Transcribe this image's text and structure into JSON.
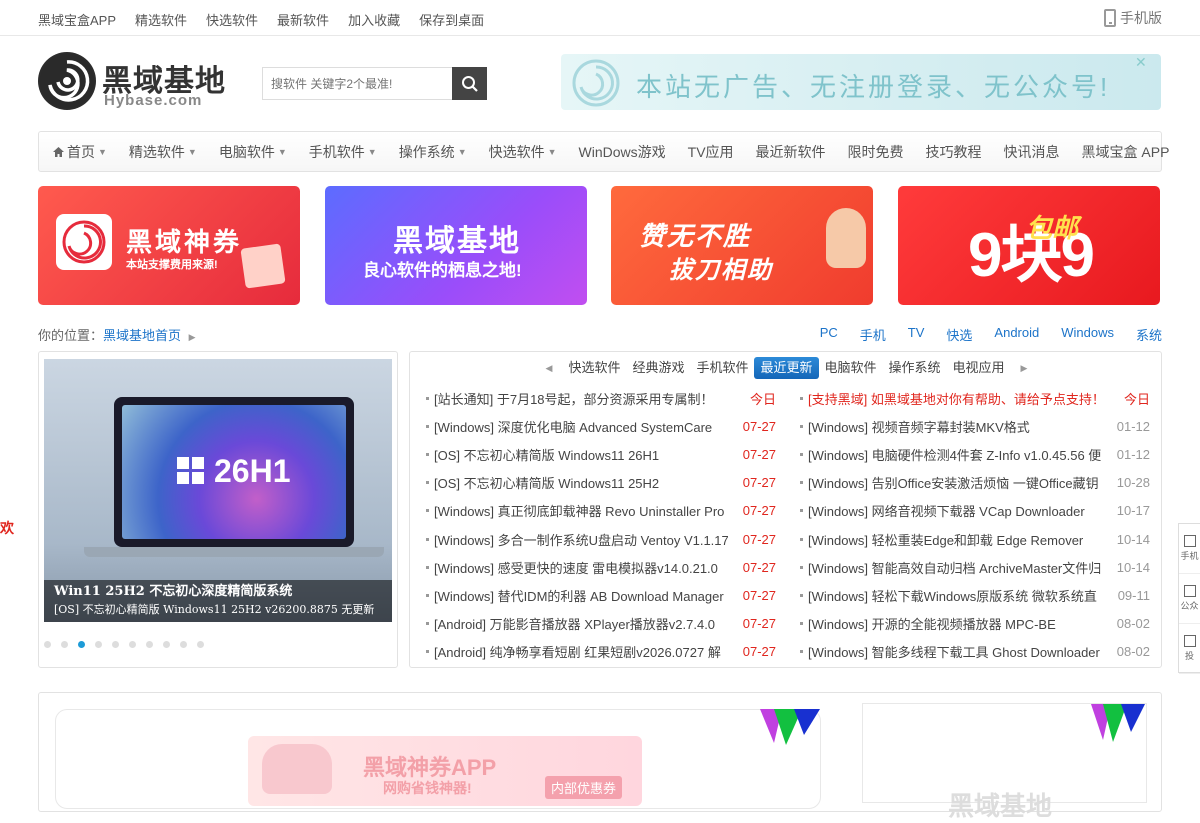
{
  "topbar": {
    "links": [
      "黑域宝盒APP",
      "精选软件",
      "快选软件",
      "最新软件",
      "加入收藏",
      "保存到桌面"
    ],
    "mobile_label": "手机版"
  },
  "header": {
    "logo_text": "黑域基地",
    "logo_sub": "Hybase.com",
    "search_placeholder": "搜软件 关键字2个最准!",
    "banner_text": "本站无广告、无注册登录、无公众号!"
  },
  "nav": {
    "items": [
      {
        "label": "首页",
        "caret": true
      },
      {
        "label": "精选软件",
        "caret": true
      },
      {
        "label": "电脑软件",
        "caret": true
      },
      {
        "label": "手机软件",
        "caret": true
      },
      {
        "label": "操作系统",
        "caret": true
      },
      {
        "label": "快选软件",
        "caret": true
      },
      {
        "label": "WinDows游戏",
        "caret": false
      },
      {
        "label": "TV应用",
        "caret": false
      },
      {
        "label": "最近新软件",
        "caret": false
      },
      {
        "label": "限时免费",
        "caret": false
      },
      {
        "label": "技巧教程",
        "caret": false
      },
      {
        "label": "快讯消息",
        "caret": false
      },
      {
        "label": "黑域宝盒 APP",
        "caret": false
      }
    ]
  },
  "promos": [
    {
      "title": "黑域神券",
      "subtitle": "本站支撑费用来源!"
    },
    {
      "title": "黑域基地",
      "subtitle": "良心软件的栖息之地!"
    },
    {
      "title": "赞无不胜",
      "subtitle": "拔刀相助"
    },
    {
      "title": "9块9",
      "subtitle": "包邮"
    }
  ],
  "breadcrumb": {
    "prefix": "你的位置：",
    "home": "黑域基地首页"
  },
  "quick_links": [
    "PC",
    "手机",
    "TV",
    "快选",
    "Android",
    "Windows",
    "系统"
  ],
  "slider": {
    "version": "26H1",
    "caption_title": "Win11 25H2 不忘初心深度精简版系统",
    "caption_sub": "[OS] 不忘初心精简版 Windows11 25H2 v26200.8875 无更新",
    "dot_count": 10,
    "active_dot": 2
  },
  "news_tabs": [
    "快选软件",
    "经典游戏",
    "手机软件",
    "最近更新",
    "电脑软件",
    "操作系统",
    "电视应用"
  ],
  "news_active_tab": 3,
  "news_left": [
    {
      "title": "[站长通知] 于7月18号起，部分资源采用专属制！",
      "date": "今日",
      "red": false
    },
    {
      "title": "[Windows] 深度优化电脑 Advanced SystemCare",
      "date": "07-27",
      "red": false
    },
    {
      "title": "[OS] 不忘初心精简版 Windows11 26H1",
      "date": "07-27",
      "red": false
    },
    {
      "title": "[OS] 不忘初心精简版 Windows11 25H2",
      "date": "07-27",
      "red": false
    },
    {
      "title": "[Windows] 真正彻底卸载神器 Revo Uninstaller Pro",
      "date": "07-27",
      "red": false
    },
    {
      "title": "[Windows] 多合一制作系统U盘启动 Ventoy V1.1.17",
      "date": "07-27",
      "red": false
    },
    {
      "title": "[Windows] 感受更快的速度 雷电模拟器v14.0.21.0",
      "date": "07-27",
      "red": false
    },
    {
      "title": "[Windows] 替代IDM的利器 AB Download Manager",
      "date": "07-27",
      "red": false
    },
    {
      "title": "[Android] 万能影音播放器 XPlayer播放器v2.7.4.0",
      "date": "07-27",
      "red": false
    },
    {
      "title": "[Android] 纯净畅享看短剧 红果短剧v2026.0727 解",
      "date": "07-27",
      "red": false
    }
  ],
  "news_right": [
    {
      "title": "[支持黑域] 如黑域基地对你有帮助、请给予点支持！",
      "date": "今日",
      "red": true
    },
    {
      "title": "[Windows] 视频音频字幕封装MKV格式",
      "date": "01-12",
      "red": false
    },
    {
      "title": "[Windows] 电脑硬件检测4件套 Z-Info v1.0.45.56 便",
      "date": "01-12",
      "red": false
    },
    {
      "title": "[Windows] 告别Office安装激活烦恼 一键Office藏钥",
      "date": "10-28",
      "red": false
    },
    {
      "title": "[Windows] 网络音视频下载器 VCap Downloader",
      "date": "10-17",
      "red": false
    },
    {
      "title": "[Windows] 轻松重装Edge和卸载 Edge Remover",
      "date": "10-14",
      "red": false
    },
    {
      "title": "[Windows] 智能高效自动归档 ArchiveMaster文件归",
      "date": "10-14",
      "red": false
    },
    {
      "title": "[Windows] 轻松下载Windows原版系统 微软系统直",
      "date": "09-11",
      "red": false
    },
    {
      "title": "[Windows] 开源的全能视频播放器 MPC-BE",
      "date": "08-02",
      "red": false
    },
    {
      "title": "[Windows] 智能多线程下载工具 Ghost Downloader",
      "date": "08-02",
      "red": false
    }
  ],
  "bottom": {
    "ad_title": "黑域神券APP",
    "ad_sub": "网购省钱神器!",
    "ad_badge": "内部优惠券",
    "right_text": "黑域基地"
  },
  "float_tools": [
    "手机",
    "公众",
    "投"
  ],
  "left_fragment": "欢",
  "colors": {
    "link_blue": "#1d74c9",
    "accent_red": "#e0261e",
    "tab_active": "#1d6fc4"
  }
}
